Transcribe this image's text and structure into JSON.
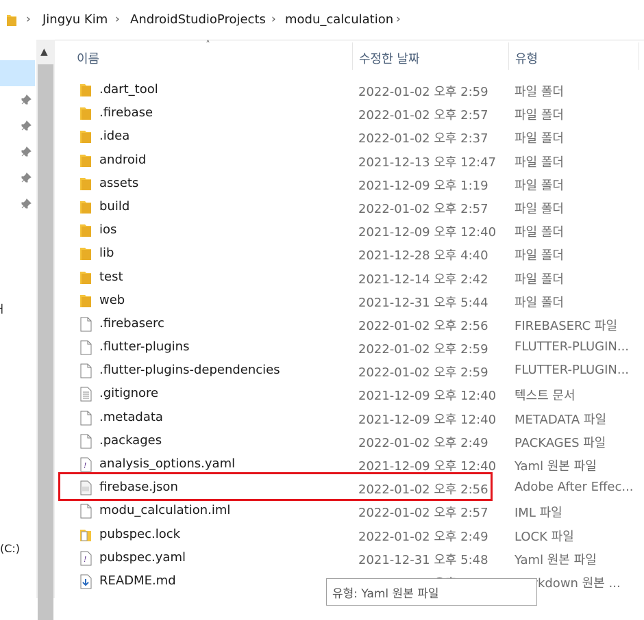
{
  "address_bar": {
    "segments": [
      "Jingyu Kim",
      "AndroidStudioProjects",
      "modu_calculation"
    ]
  },
  "nav": {
    "fragments": [
      "ㅓ",
      "(C:)"
    ]
  },
  "columns": {
    "name": "이름",
    "date": "수정한 날짜",
    "type": "유형"
  },
  "files": [
    {
      "name": ".dart_tool",
      "date": "2022-01-02 오후 2:59",
      "type": "파일 폴더",
      "icon": "folder-icon"
    },
    {
      "name": ".firebase",
      "date": "2022-01-02 오후 2:57",
      "type": "파일 폴더",
      "icon": "folder-icon"
    },
    {
      "name": ".idea",
      "date": "2022-01-02 오후 2:37",
      "type": "파일 폴더",
      "icon": "folder-icon"
    },
    {
      "name": "android",
      "date": "2021-12-13 오후 12:47",
      "type": "파일 폴더",
      "icon": "folder-icon"
    },
    {
      "name": "assets",
      "date": "2021-12-09 오후 1:19",
      "type": "파일 폴더",
      "icon": "folder-icon"
    },
    {
      "name": "build",
      "date": "2022-01-02 오후 2:57",
      "type": "파일 폴더",
      "icon": "folder-icon"
    },
    {
      "name": "ios",
      "date": "2021-12-09 오후 12:40",
      "type": "파일 폴더",
      "icon": "folder-icon"
    },
    {
      "name": "lib",
      "date": "2021-12-28 오후 4:40",
      "type": "파일 폴더",
      "icon": "folder-icon"
    },
    {
      "name": "test",
      "date": "2021-12-14 오후 2:42",
      "type": "파일 폴더",
      "icon": "folder-icon"
    },
    {
      "name": "web",
      "date": "2021-12-31 오후 5:44",
      "type": "파일 폴더",
      "icon": "folder-icon"
    },
    {
      "name": ".firebaserc",
      "date": "2022-01-02 오후 2:56",
      "type": "FIREBASERC 파일",
      "icon": "blank-file-icon"
    },
    {
      "name": ".flutter-plugins",
      "date": "2022-01-02 오후 2:59",
      "type": "FLUTTER-PLUGIN...",
      "icon": "blank-file-icon"
    },
    {
      "name": ".flutter-plugins-dependencies",
      "date": "2022-01-02 오후 2:59",
      "type": "FLUTTER-PLUGIN...",
      "icon": "blank-file-icon"
    },
    {
      "name": ".gitignore",
      "date": "2021-12-09 오후 12:40",
      "type": "텍스트 문서",
      "icon": "text-file-icon"
    },
    {
      "name": ".metadata",
      "date": "2021-12-09 오후 12:40",
      "type": "METADATA 파일",
      "icon": "blank-file-icon"
    },
    {
      "name": ".packages",
      "date": "2022-01-02 오후 2:49",
      "type": "PACKAGES 파일",
      "icon": "blank-file-icon"
    },
    {
      "name": "analysis_options.yaml",
      "date": "2021-12-09 오후 12:40",
      "type": "Yaml 원본 파일",
      "icon": "yaml-file-icon"
    },
    {
      "name": "firebase.json",
      "date": "2022-01-02 오후 2:56",
      "type": "Adobe After Effec...",
      "icon": "json-file-icon"
    },
    {
      "name": "modu_calculation.iml",
      "date": "2022-01-02 오후 2:57",
      "type": "IML 파일",
      "icon": "blank-file-icon"
    },
    {
      "name": "pubspec.lock",
      "date": "2022-01-02 오후 2:49",
      "type": "LOCK 파일",
      "icon": "lock-file-icon"
    },
    {
      "name": "pubspec.yaml",
      "date": "2021-12-31 오후 5:48",
      "type": "Yaml 원본 파일",
      "icon": "yaml-file-icon"
    },
    {
      "name": "README.md",
      "date": "2021-12-09 오후 12:40",
      "type": "Markdown 원본 ...",
      "icon": "markdown-file-icon"
    }
  ],
  "tooltip": {
    "text": "유형: Yaml 원본 파일"
  },
  "colors": {
    "highlight_border": "#e3141b",
    "selection": "#cce8ff",
    "folder": "#f5c43c"
  }
}
